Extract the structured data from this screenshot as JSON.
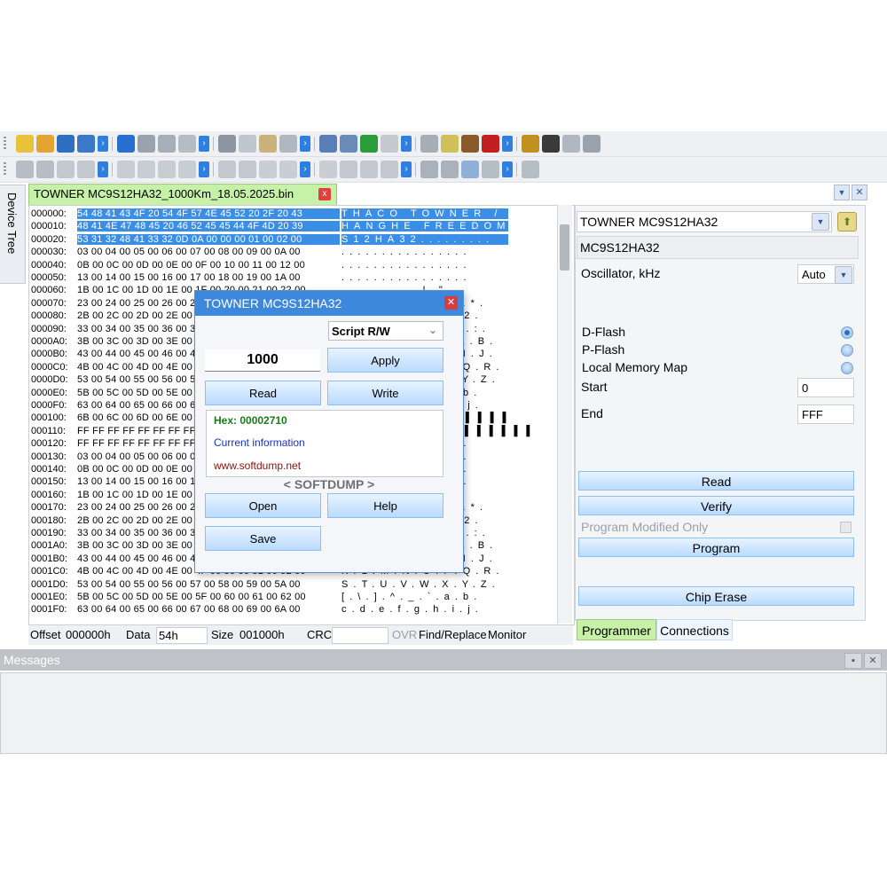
{
  "toolbars": {
    "row1_icons": [
      "chip-icon",
      "open-folder-icon",
      "save-icon",
      "edit-icon",
      "undo-icon",
      "redo-icon",
      "cut-icon",
      "copy-icon",
      "paste-icon",
      "delete-icon",
      "find-icon",
      "find-replace-icon",
      "document-icon",
      "ff-icon",
      "00-icon",
      "refresh-icon",
      "page-icon",
      "page2-icon",
      "grid-icon",
      "notes-icon",
      "tools-icon",
      "bug-icon",
      "sigma-icon",
      "network-icon"
    ],
    "row2_icons": [
      "zoom-in-icon",
      "zoom-out-icon",
      "fit-icon",
      "move-icon",
      "first-icon",
      "prev-icon",
      "next-icon",
      "last-icon",
      "back-icon",
      "forward-icon",
      "bold-icon",
      "italic-icon",
      "underline-icon",
      "align-left-icon",
      "align-center-icon",
      "align-right-icon",
      "play-icon",
      "stop-icon",
      "pointer-icon",
      "zoom-rect-icon",
      "frame-icon"
    ]
  },
  "side_tab": "Device Tree",
  "doc_tab": {
    "title": "TOWNER MC9S12HA32_1000Km_18.05.2025.bin",
    "close": "x"
  },
  "hex_rows": [
    {
      "off": "000000:",
      "hex": "54 48 41 43 4F 20 54 4F 57 4E 45 52 20 2F 20 43",
      "asc": "THACO TOWNER / C",
      "sel": true
    },
    {
      "off": "000010:",
      "hex": "48 41 4E 47 48 45 20 46 52 45 45 44 4F 4D 20 39",
      "asc": "HANGHE FREEDOM 9",
      "sel": true
    },
    {
      "off": "000020:",
      "hex": "53 31 32 48 41 33 32 0D 0A 00 00 00 01 00 02 00",
      "asc": "S12HA32.........",
      "sel": true
    },
    {
      "off": "000030:",
      "hex": "03 00 04 00 05 00 06 00 07 00 08 00 09 00 0A 00",
      "asc": "................"
    },
    {
      "off": "000040:",
      "hex": "0B 00 0C 00 0D 00 0E 00 0F 00 10 00 11 00 12 00",
      "asc": "................"
    },
    {
      "off": "000050:",
      "hex": "13 00 14 00 15 00 16 00 17 00 18 00 19 00 1A 00",
      "asc": "................"
    },
    {
      "off": "000060:",
      "hex": "1B 00 1C 00 1D 00 1E 00 1F 00 20 00 21 00 22 00",
      "asc": "........ .!.\"."
    },
    {
      "off": "000070:",
      "hex": "23 00 24 00 25 00 26 00 27 00 28 00 29 00 2A 00",
      "asc": "#.$.%.&.'.(.).*."
    },
    {
      "off": "000080:",
      "hex": "2B 00 2C 00 2D 00 2E 00 2F 00 30 00 31 00 32 00",
      "asc": "+.,.-.../.0.1.2."
    },
    {
      "off": "000090:",
      "hex": "33 00 34 00 35 00 36 00 37 00 38 00 39 00 3A 00",
      "asc": "3.4.5.6.7.8.9.:."
    },
    {
      "off": "0000A0:",
      "hex": "3B 00 3C 00 3D 00 3E 00 3F 00 40 00 41 00 42 00",
      "asc": ";.<.=.>.?.@.A.B."
    },
    {
      "off": "0000B0:",
      "hex": "43 00 44 00 45 00 46 00 47 00 48 00 49 00 4A 00",
      "asc": "C.D.E.F.G.H.I.J."
    },
    {
      "off": "0000C0:",
      "hex": "4B 00 4C 00 4D 00 4E 00 4F 00 50 00 51 00 52 00",
      "asc": "K.L.M.N.O.P.Q.R."
    },
    {
      "off": "0000D0:",
      "hex": "53 00 54 00 55 00 56 00 57 00 58 00 59 00 5A 00",
      "asc": "S.T.U.V.W.X.Y.Z."
    },
    {
      "off": "0000E0:",
      "hex": "5B 00 5C 00 5D 00 5E 00 5F 00 60 00 61 00 62 00",
      "asc": "[.\\.].^._.`.a.b."
    },
    {
      "off": "0000F0:",
      "hex": "63 00 64 00 65 00 66 00 67 00 68 00 69 00 6A 00",
      "asc": "c.d.e.f.g.h.i.j."
    },
    {
      "off": "000100:",
      "hex": "6B 00 6C 00 6D 00 6E 00 FF FF FF FF FF FF FF FF",
      "asc": "k.l.m.n.▌▌▌▌▌▌▌▌"
    },
    {
      "off": "000110:",
      "hex": "FF FF FF FF FF FF FF FF FF FF FF FF FF FF FF FF",
      "asc": "▌▌▌▌▌▌▌▌▌▌▌▌▌▌▌▌"
    },
    {
      "off": "000120:",
      "hex": "FF FF FF FF FF FF FF FF FF FF FF FF FF FF FF FF",
      "asc": "................"
    },
    {
      "off": "000130:",
      "hex": "03 00 04 00 05 00 06 00 07 00 08 00 09 00 0A 00",
      "asc": "................"
    },
    {
      "off": "000140:",
      "hex": "0B 00 0C 00 0D 00 0E 00 0F 00 10 00 11 00 12 00",
      "asc": "................"
    },
    {
      "off": "000150:",
      "hex": "13 00 14 00 15 00 16 00 17 00 18 00 19 00 1A 00",
      "asc": "................"
    },
    {
      "off": "000160:",
      "hex": "1B 00 1C 00 1D 00 1E 00 1F 00 20 00 21 00 22 00",
      "asc": "........ .!.\"."
    },
    {
      "off": "000170:",
      "hex": "23 00 24 00 25 00 26 00 27 00 28 00 29 00 2A 00",
      "asc": "#.$.%.&.'.(.).*."
    },
    {
      "off": "000180:",
      "hex": "2B 00 2C 00 2D 00 2E 00 2F 00 30 00 31 00 32 00",
      "asc": "+.,.-.../.0.1.2."
    },
    {
      "off": "000190:",
      "hex": "33 00 34 00 35 00 36 00 37 00 38 00 39 00 3A 00",
      "asc": "3.4.5.6.7.8.9.:."
    },
    {
      "off": "0001A0:",
      "hex": "3B 00 3C 00 3D 00 3E 00 3F 00 40 00 41 00 42 00",
      "asc": ";.<.=.>.?.@.A.B."
    },
    {
      "off": "0001B0:",
      "hex": "43 00 44 00 45 00 46 00 47 00 48 00 49 00 4A 00",
      "asc": "C.D.E.F.G.H.I.J."
    },
    {
      "off": "0001C0:",
      "hex": "4B 00 4C 00 4D 00 4E 00 4F 00 50 00 51 00 52 00",
      "asc": "K.L.M.N.O.P.Q.R."
    },
    {
      "off": "0001D0:",
      "hex": "53 00 54 00 55 00 56 00 57 00 58 00 59 00 5A 00",
      "asc": "S.T.U.V.W.X.Y.Z."
    },
    {
      "off": "0001E0:",
      "hex": "5B 00 5C 00 5D 00 5E 00 5F 00 60 00 61 00 62 00",
      "asc": "[.\\.].^._.`.a.b."
    },
    {
      "off": "0001F0:",
      "hex": "63 00 64 00 65 00 66 00 67 00 68 00 69 00 6A 00",
      "asc": "c.d.e.f.g.h.i.j."
    }
  ],
  "status": {
    "offset_label": "Offset",
    "offset_value": "000000h",
    "data_label": "Data",
    "data_value": "54h",
    "size_label": "Size",
    "size_value": "001000h",
    "crc_label": "CRC",
    "crc_value": "",
    "ovr": "OVR",
    "find_replace": "Find/Replace",
    "monitor": "Monitor"
  },
  "right_panel": {
    "device_combo": "TOWNER MC9S12HA32",
    "chip_name": "MC9S12HA32",
    "oscillator_label": "Oscillator, kHz",
    "oscillator_value": "Auto",
    "memory_options": [
      "D-Flash",
      "P-Flash",
      "Local Memory Map"
    ],
    "memory_selected": 0,
    "start_label": "Start",
    "start_value": "0",
    "end_label": "End",
    "end_value": "FFF",
    "read_btn": "Read",
    "verify_btn": "Verify",
    "program_modified_label": "Program Modified Only",
    "program_btn": "Program",
    "chip_erase_btn": "Chip Erase",
    "tabs": [
      "Programmer",
      "Connections"
    ]
  },
  "messages": {
    "title": "Messages"
  },
  "dialog": {
    "title": "TOWNER MC9S12HA32",
    "mode": "Script R/W",
    "value": "1000",
    "apply": "Apply",
    "read": "Read",
    "write": "Write",
    "hex_info": "Hex: 00002710",
    "current_info": "Current information",
    "website": "www.softdump.net",
    "brand": "< SOFTDUMP >",
    "open": "Open",
    "help": "Help",
    "save": "Save"
  },
  "colors": {
    "accent": "#3d88da",
    "selection": "#3a8ee6",
    "tab_green": "#c7f0a8",
    "hex_green": "#1a7a1a",
    "info_blue": "#1a2fc0",
    "link_red": "#8b1010"
  }
}
